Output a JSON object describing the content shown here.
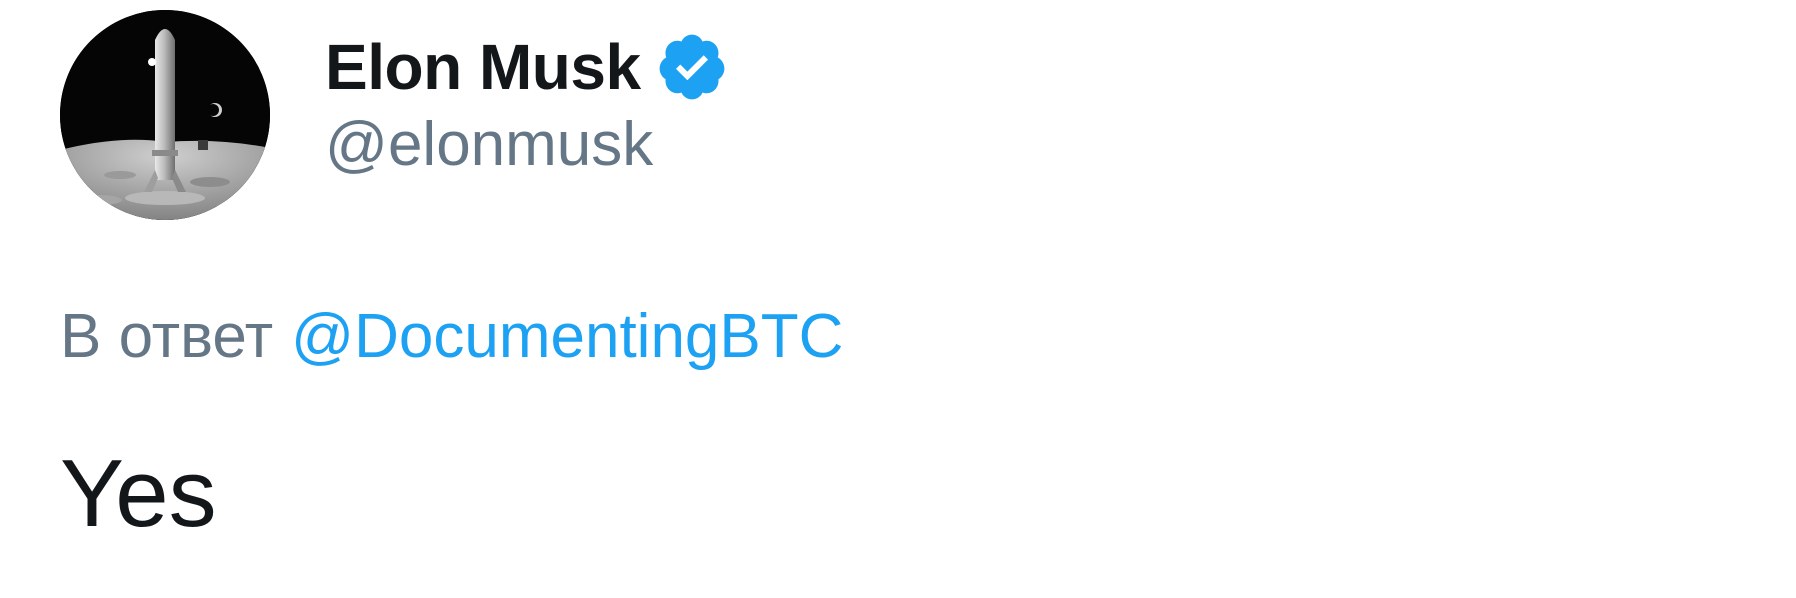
{
  "author": {
    "display_name": "Elon Musk",
    "handle": "@elonmusk",
    "verified": true,
    "avatar_icon": "starship-on-moon-avatar",
    "verified_icon": "verified-badge-icon"
  },
  "reply": {
    "prefix": "В ответ",
    "target": "@DocumentingBTC"
  },
  "tweet": {
    "text": "Yes"
  },
  "colors": {
    "text_primary": "#14171a",
    "text_secondary": "#657786",
    "accent": "#1da1f2",
    "background": "#ffffff"
  }
}
